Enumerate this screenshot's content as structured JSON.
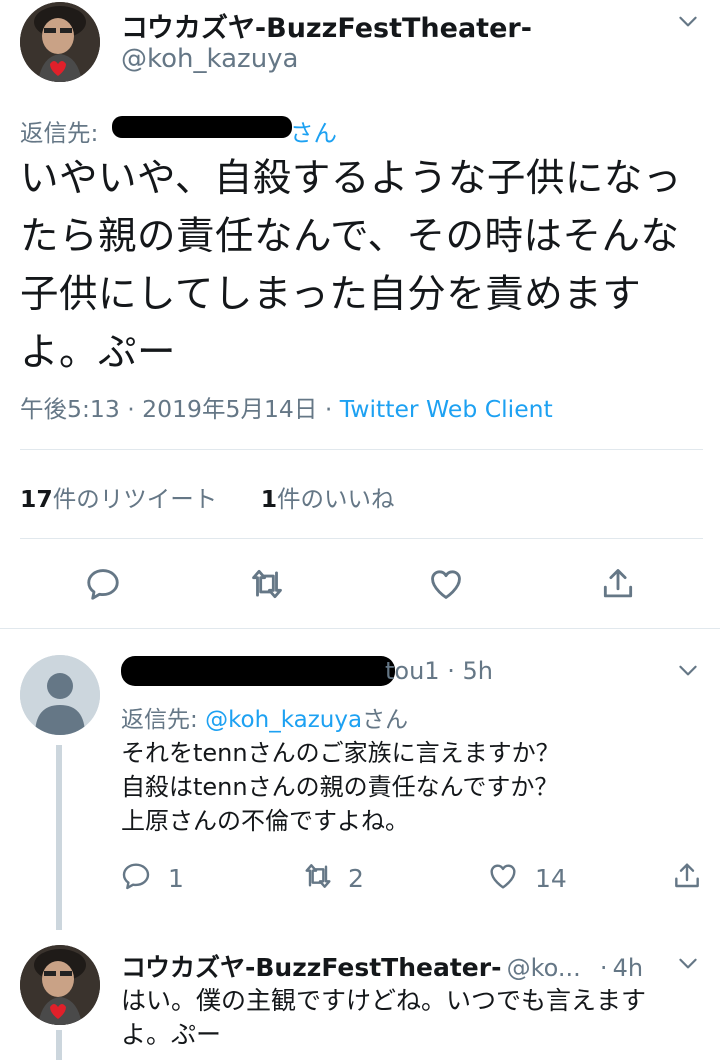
{
  "main_tweet": {
    "display_name": "コウカズヤ-BuzzFestTheater-",
    "handle": "@koh_kazuya",
    "reply_to_label": "返信先:",
    "reply_to_suffix": "さん",
    "text_lines": [
      "いやいや、自殺するような子供になっ",
      "たら親の責任なんで、その時はそんな",
      "子供にしてしまった自分を責めます",
      "よ。ぷー"
    ],
    "timestamp": "午後5:13 · 2019年5月14日",
    "separator": "·",
    "client": "Twitter Web Client",
    "retweet_count": "17",
    "retweet_label": "件のリツイート",
    "like_count": "1",
    "like_label": "件のいいね"
  },
  "reply1": {
    "handle_partial": "tou1",
    "separator": "·",
    "time": "5h",
    "reply_to_label": "返信先:",
    "reply_to_handle": "@koh_kazuya",
    "reply_to_suffix": "さん",
    "text_lines": [
      "それをtennさんのご家族に言えますか？",
      "自殺はtennさんの親の責任なんですか？",
      "上原さんの不倫ですよね。"
    ],
    "reply_count": "1",
    "retweet_count": "2",
    "like_count": "14"
  },
  "reply2": {
    "display_name": "コウカズヤ-BuzzFestTheater-",
    "handle": "@ko...",
    "separator": "·",
    "time": "4h",
    "text_lines": [
      "はい。僕の主観ですけどね。いつでも言えます",
      "よ。ぷー"
    ]
  },
  "colors": {
    "link": "#1da1f2",
    "muted": "#657786",
    "divider": "#e1e8ed",
    "thread_line": "#ccd6dd"
  },
  "icons": [
    "chevron-down-icon",
    "reply-icon",
    "retweet-icon",
    "like-icon",
    "share-icon",
    "default-avatar-icon"
  ]
}
